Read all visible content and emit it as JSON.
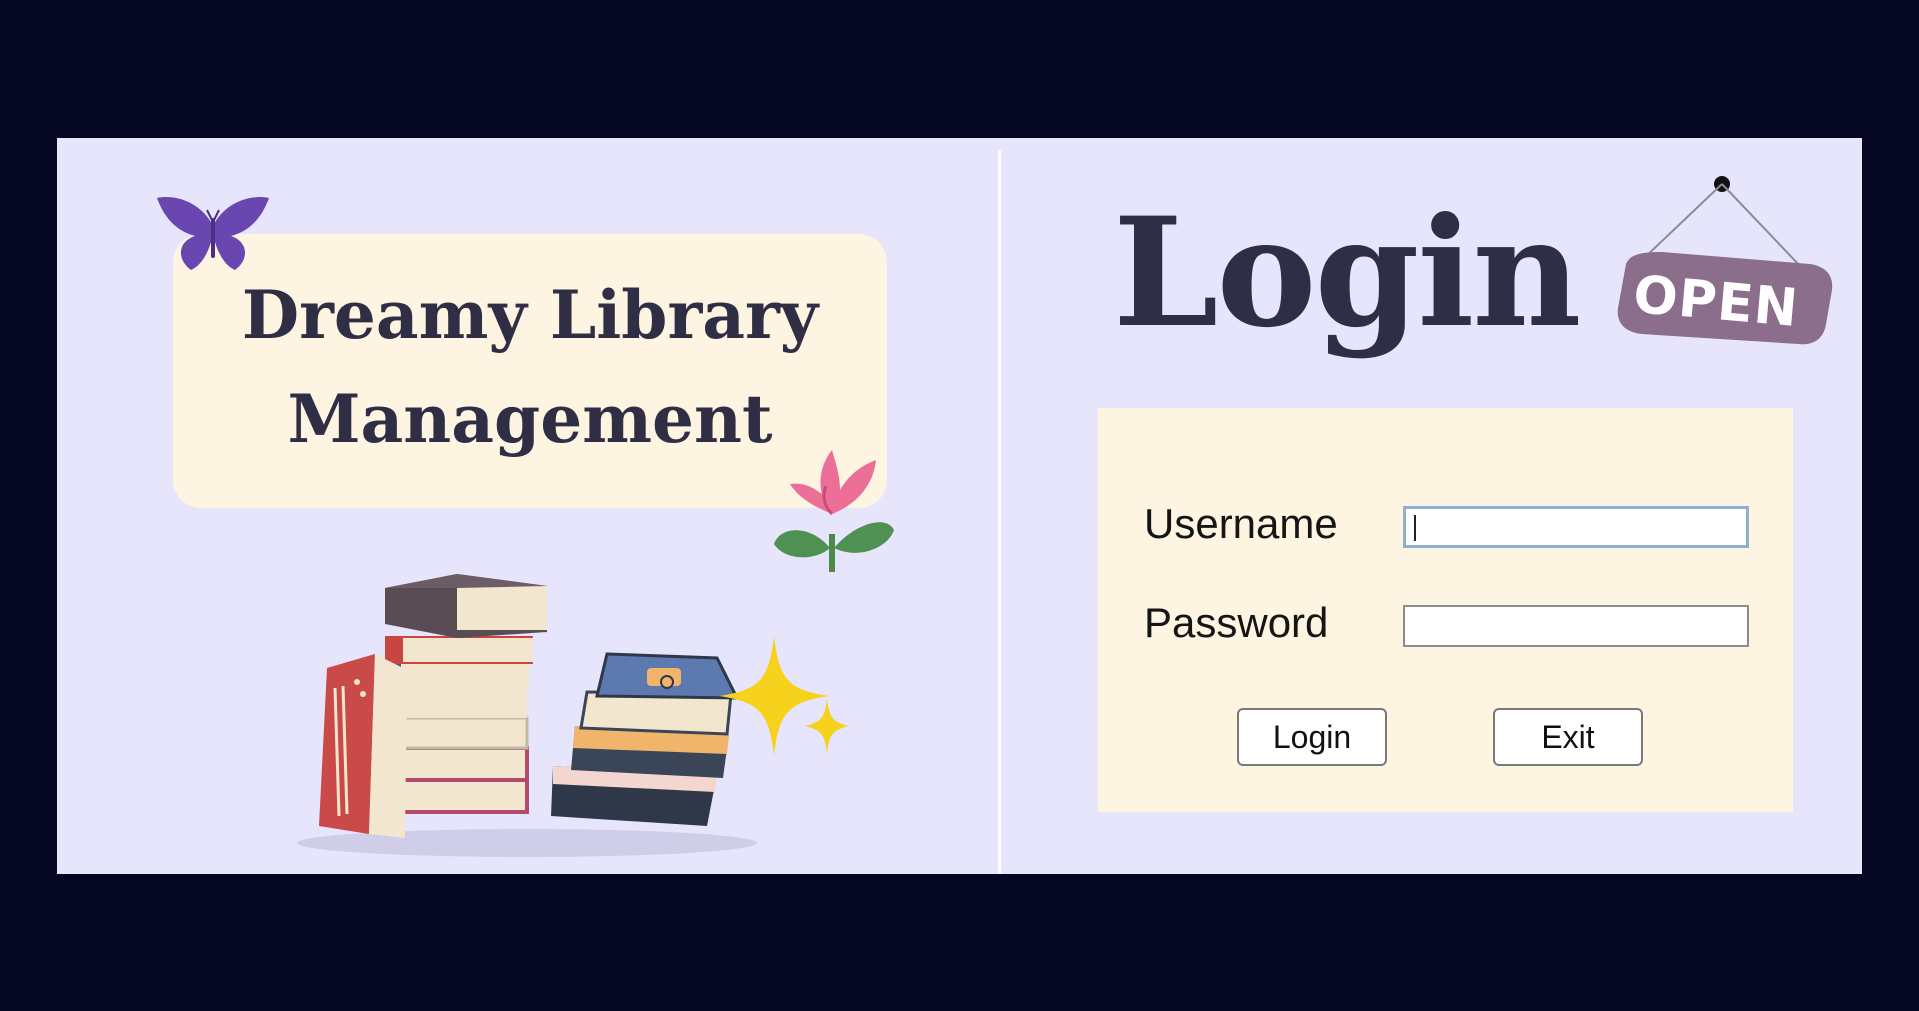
{
  "app": {
    "title_line1": "Dreamy Library",
    "title_line2": "Management"
  },
  "login_panel": {
    "heading": "Login",
    "sign_text": "OPEN",
    "username_label": "Username",
    "username_value": "",
    "password_label": "Password",
    "password_value": "",
    "login_button": "Login",
    "exit_button": "Exit"
  },
  "colors": {
    "backdrop": "#050722",
    "panel_bg": "#e6e5fc",
    "card_bg": "#fdf5e2",
    "title_text": "#2f2e44",
    "sign_bg": "#8a6e8c"
  }
}
